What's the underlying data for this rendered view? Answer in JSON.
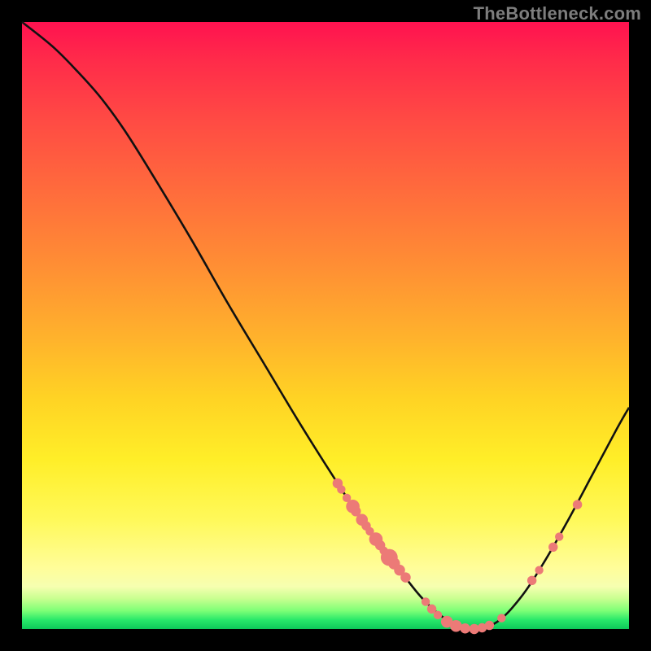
{
  "attribution": "TheBottleneck.com",
  "chart_data": {
    "type": "line",
    "title": "",
    "xlabel": "",
    "ylabel": "",
    "xlim": [
      0,
      100
    ],
    "ylim": [
      0,
      100
    ],
    "curve": [
      {
        "x": 0.0,
        "y": 100.0
      },
      {
        "x": 5.0,
        "y": 96.0
      },
      {
        "x": 9.0,
        "y": 92.0
      },
      {
        "x": 13.0,
        "y": 87.5
      },
      {
        "x": 17.0,
        "y": 82.0
      },
      {
        "x": 22.0,
        "y": 74.0
      },
      {
        "x": 28.0,
        "y": 64.0
      },
      {
        "x": 34.0,
        "y": 53.5
      },
      {
        "x": 40.0,
        "y": 43.5
      },
      {
        "x": 46.0,
        "y": 33.5
      },
      {
        "x": 52.0,
        "y": 24.0
      },
      {
        "x": 57.0,
        "y": 16.5
      },
      {
        "x": 62.0,
        "y": 10.0
      },
      {
        "x": 66.0,
        "y": 5.0
      },
      {
        "x": 70.0,
        "y": 1.5
      },
      {
        "x": 74.0,
        "y": 0.0
      },
      {
        "x": 78.0,
        "y": 1.0
      },
      {
        "x": 82.0,
        "y": 5.0
      },
      {
        "x": 86.0,
        "y": 11.0
      },
      {
        "x": 90.0,
        "y": 18.0
      },
      {
        "x": 94.0,
        "y": 25.5
      },
      {
        "x": 98.0,
        "y": 33.0
      },
      {
        "x": 100.0,
        "y": 36.5
      }
    ],
    "markers": [
      {
        "x": 52.0,
        "y": 24.0,
        "r": 1.2
      },
      {
        "x": 52.6,
        "y": 23.0,
        "r": 1.0
      },
      {
        "x": 53.5,
        "y": 21.6,
        "r": 1.0
      },
      {
        "x": 54.5,
        "y": 20.2,
        "r": 1.6
      },
      {
        "x": 55.0,
        "y": 19.4,
        "r": 1.2
      },
      {
        "x": 56.0,
        "y": 18.0,
        "r": 1.4
      },
      {
        "x": 56.7,
        "y": 17.0,
        "r": 1.1
      },
      {
        "x": 57.3,
        "y": 16.1,
        "r": 1.0
      },
      {
        "x": 58.3,
        "y": 14.8,
        "r": 1.6
      },
      {
        "x": 59.0,
        "y": 13.8,
        "r": 1.2
      },
      {
        "x": 59.6,
        "y": 12.9,
        "r": 1.0
      },
      {
        "x": 60.5,
        "y": 11.8,
        "r": 2.0
      },
      {
        "x": 61.3,
        "y": 10.8,
        "r": 1.4
      },
      {
        "x": 62.2,
        "y": 9.7,
        "r": 1.3
      },
      {
        "x": 63.2,
        "y": 8.5,
        "r": 1.2
      },
      {
        "x": 66.5,
        "y": 4.5,
        "r": 1.0
      },
      {
        "x": 67.5,
        "y": 3.3,
        "r": 1.1
      },
      {
        "x": 68.5,
        "y": 2.3,
        "r": 1.0
      },
      {
        "x": 70.0,
        "y": 1.2,
        "r": 1.4
      },
      {
        "x": 71.5,
        "y": 0.5,
        "r": 1.4
      },
      {
        "x": 73.0,
        "y": 0.1,
        "r": 1.2
      },
      {
        "x": 74.5,
        "y": 0.0,
        "r": 1.2
      },
      {
        "x": 75.8,
        "y": 0.2,
        "r": 1.1
      },
      {
        "x": 77.0,
        "y": 0.6,
        "r": 1.1
      },
      {
        "x": 79.0,
        "y": 1.8,
        "r": 1.0
      },
      {
        "x": 84.0,
        "y": 8.0,
        "r": 1.1
      },
      {
        "x": 85.2,
        "y": 9.7,
        "r": 1.0
      },
      {
        "x": 87.5,
        "y": 13.5,
        "r": 1.1
      },
      {
        "x": 88.5,
        "y": 15.2,
        "r": 1.0
      },
      {
        "x": 91.5,
        "y": 20.5,
        "r": 1.1
      }
    ]
  }
}
